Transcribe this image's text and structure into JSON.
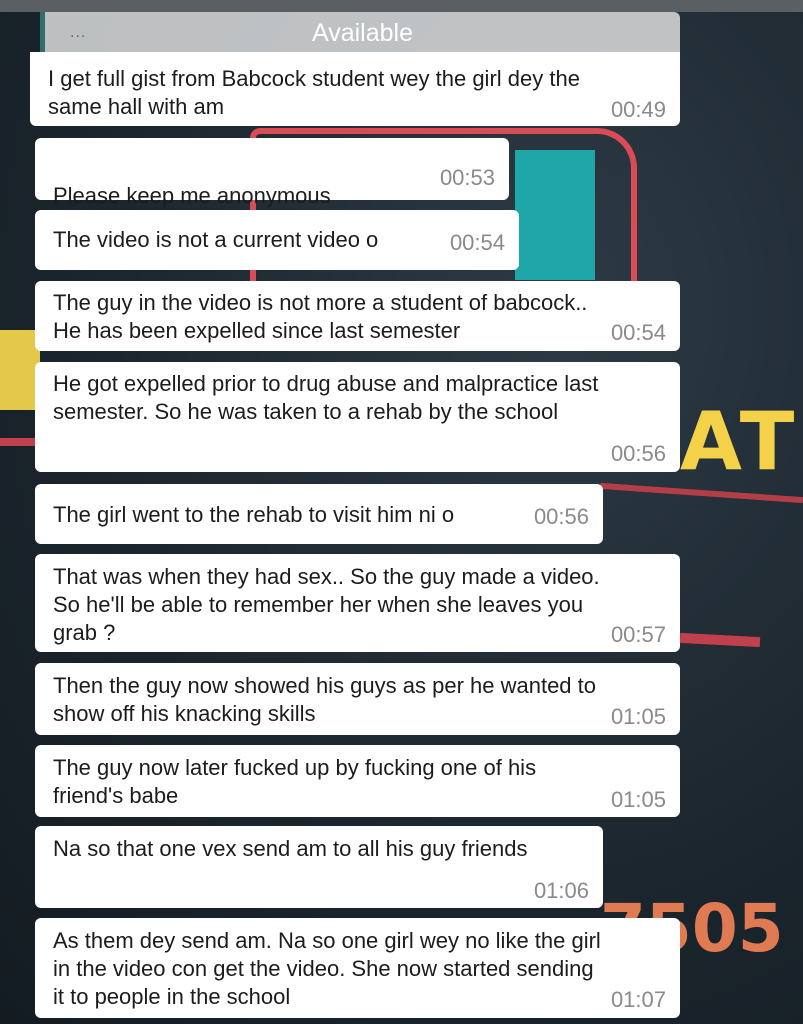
{
  "header": {
    "status": "Available",
    "dots": "..."
  },
  "messages": [
    {
      "text": "I get full gist from Babcock student wey the girl dey the\nsame hall with am",
      "time": "00:49"
    },
    {
      "text": "Please keep me anonymous",
      "emoji": "🙏",
      "time": "00:53"
    },
    {
      "text": "The video is not a current video o",
      "time": "00:54"
    },
    {
      "text": "The guy in the video is not more a student of babcock..\nHe has been expelled since last semester",
      "time": "00:54"
    },
    {
      "text": "He got expelled prior to drug abuse and malpractice last\nsemester. So he was taken to a rehab by the school",
      "time": "00:56"
    },
    {
      "text": "The girl went to the rehab to visit him ni o",
      "time": "00:56"
    },
    {
      "text": "That was when they had sex.. So the guy made a video.\nSo he'll be able to remember her when she leaves you\ngrab ?",
      "time": "00:57"
    },
    {
      "text": "Then the guy now showed his guys as per he wanted to\nshow off his knacking skills",
      "time": "01:05"
    },
    {
      "text": "The guy now later fucked up by fucking one of his\nfriend's babe",
      "time": "01:05"
    },
    {
      "text": "Na so that one vex send am to all his guy friends",
      "time": "01:06"
    },
    {
      "text": "As them dey send am. Na so one girl wey no like the girl\nin the video con get the video. She now started sending\nit to people in the school",
      "time": "01:07"
    }
  ],
  "wallpaper": {
    "text_1": "ATI",
    "text_2": "7505"
  },
  "colors": {
    "bubble": "#ffffff",
    "time": "#8a8a8a",
    "accent": "#2f6f6a"
  }
}
